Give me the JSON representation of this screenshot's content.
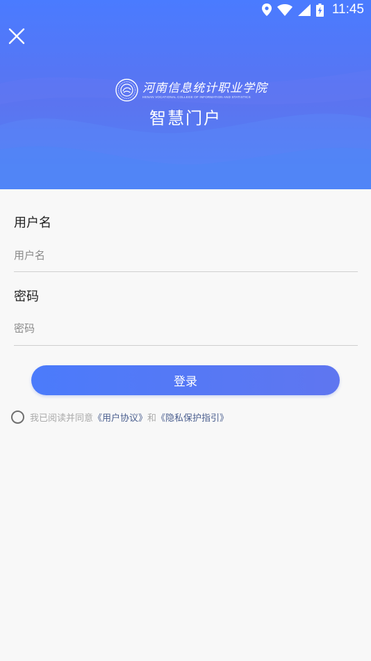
{
  "status_bar": {
    "time": "11:45",
    "icons": [
      "location-icon",
      "wifi-icon",
      "signal-icon",
      "battery-charging-icon"
    ]
  },
  "header": {
    "close_icon": "close-icon",
    "logo": {
      "name_cn": "河南信息统计职业学院",
      "name_en": "HENAN VOCATIONAL COLLEGE OF INFORMATION AND STATISTICS"
    },
    "portal_title": "智慧门户",
    "colors": {
      "gradient_top": "#4a7bff",
      "gradient_bottom": "#4f86f6"
    }
  },
  "form": {
    "username": {
      "label": "用户名",
      "placeholder": "用户名",
      "value": ""
    },
    "password": {
      "label": "密码",
      "placeholder": "密码",
      "value": ""
    },
    "login_button": "登录",
    "button_color": "#4b7bfb"
  },
  "agreement": {
    "checked": false,
    "prefix": "我已阅读并同意",
    "user_agreement": "《用户协议》",
    "conjunction": "和",
    "privacy_guide": "《隐私保护指引》",
    "link_color": "#4b5f8f"
  }
}
